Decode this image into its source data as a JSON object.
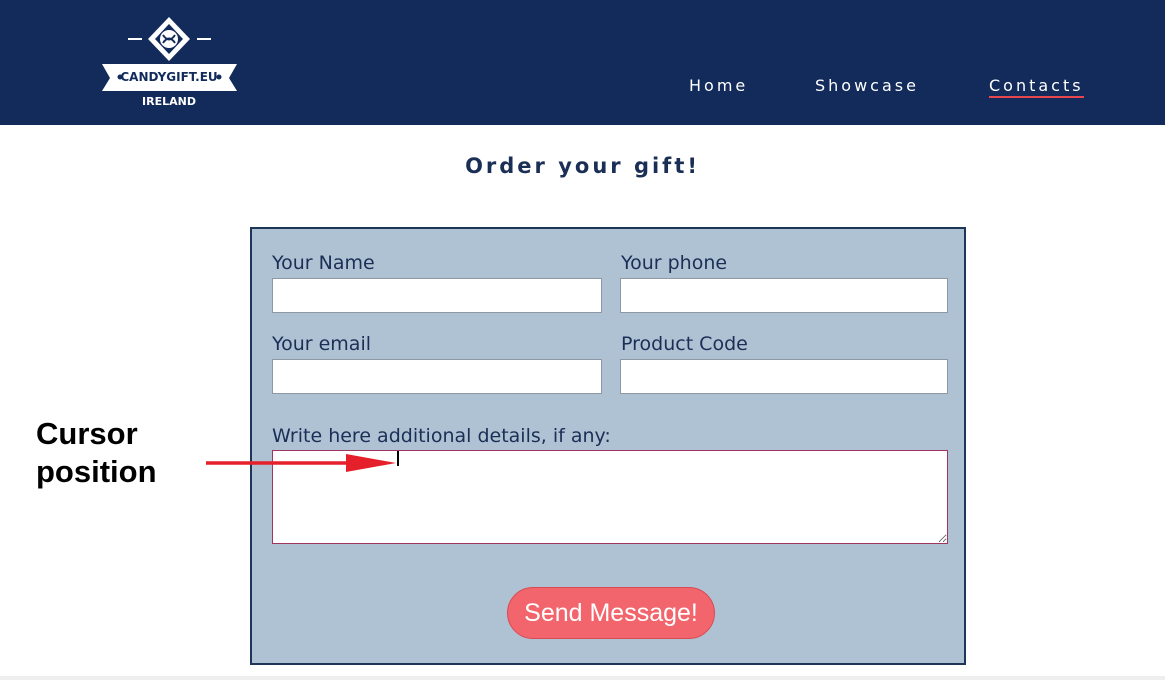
{
  "header": {
    "logo": {
      "brand": "CANDYGIFT.EU",
      "region": "IRELAND",
      "icon": "candy-icon"
    },
    "nav": [
      {
        "label": "Home",
        "active": false
      },
      {
        "label": "Showcase",
        "active": false
      },
      {
        "label": "Contacts",
        "active": true
      }
    ]
  },
  "main": {
    "title": "Order your gift!",
    "form": {
      "name_label": "Your Name",
      "name_value": "",
      "phone_label": "Your phone",
      "phone_value": "",
      "email_label": "Your email",
      "email_value": "",
      "product_label": "Product Code",
      "product_value": "",
      "details_label": "Write here additional details, if any:",
      "details_value": "",
      "submit_label": "Send Message!"
    }
  },
  "annotation": {
    "line1": "Cursor",
    "line2": "position",
    "arrow_color": "#e5202a"
  },
  "colors": {
    "header_bg": "#122b5b",
    "form_bg": "#afc2d4",
    "accent": "#f2656c",
    "title": "#1b2f56"
  }
}
